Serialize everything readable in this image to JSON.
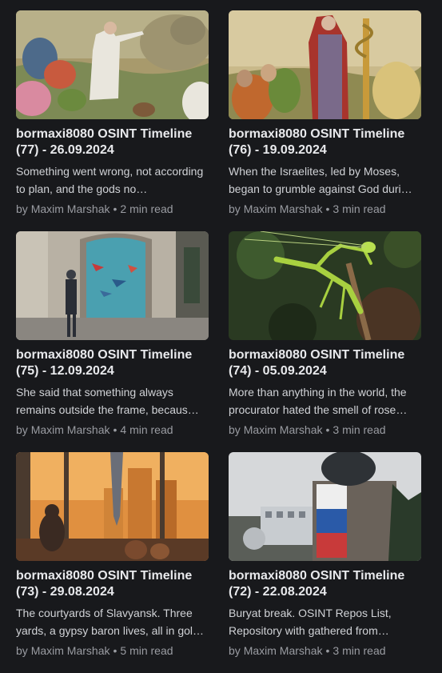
{
  "articles": [
    {
      "title": "bormaxi8080 OSINT Timeline (77) - 26.09.2024",
      "excerpt": "Something went wrong, not according to plan, and the gods no…",
      "author_prefix": "by",
      "author": "Maxim Marshak",
      "separator": "•",
      "read_time": "2 min read",
      "image": "biblical-prayer-illustration"
    },
    {
      "title": "bormaxi8080 OSINT Timeline (76) - 19.09.2024",
      "excerpt": "When the Israelites, led by Moses, began to grumble against God duri…",
      "author_prefix": "by",
      "author": "Maxim Marshak",
      "separator": "•",
      "read_time": "3 min read",
      "image": "moses-bronze-serpent-illustration"
    },
    {
      "title": "bormaxi8080 OSINT Timeline (75) - 12.09.2024",
      "excerpt": "She said that something always remains outside the frame, becaus…",
      "author_prefix": "by",
      "author": "Maxim Marshak",
      "separator": "•",
      "read_time": "4 min read",
      "image": "museum-aquarium-window-photo"
    },
    {
      "title": "bormaxi8080 OSINT Timeline (74) - 05.09.2024",
      "excerpt": "More than anything in the world, the procurator hated the smell of rose…",
      "author_prefix": "by",
      "author": "Maxim Marshak",
      "separator": "•",
      "read_time": "3 min read",
      "image": "praying-mantis-photo"
    },
    {
      "title": "bormaxi8080 OSINT Timeline (73) - 29.08.2024",
      "excerpt": "The courtyards of Slavyansk. Three yards, a gypsy baron lives, all in gol…",
      "author_prefix": "by",
      "author": "Maxim Marshak",
      "separator": "•",
      "read_time": "5 min read",
      "image": "city-window-illustration"
    },
    {
      "title": "bormaxi8080 OSINT Timeline (72) - 22.08.2024",
      "excerpt": "Buryat break. OSINT Repos List, Repository with gathered from…",
      "author_prefix": "by",
      "author": "Maxim Marshak",
      "separator": "•",
      "read_time": "3 min read",
      "image": "monument-painted-pedestal-photo"
    }
  ]
}
